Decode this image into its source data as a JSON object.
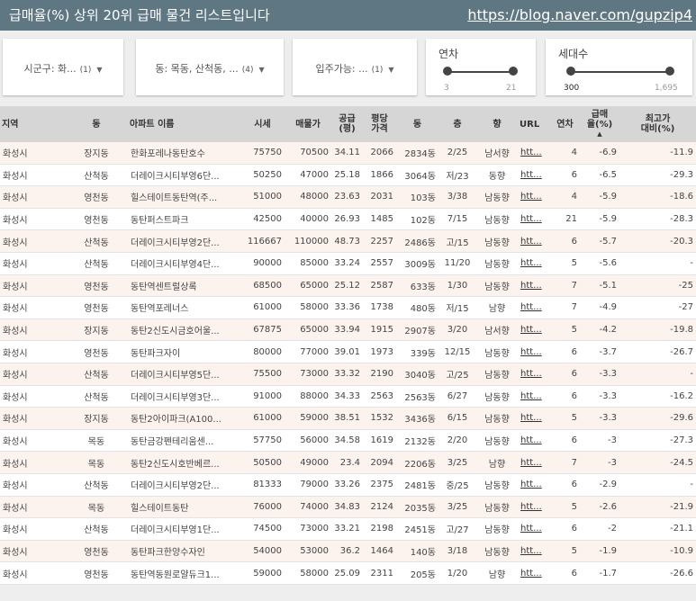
{
  "header": {
    "title": "급매율(%) 상위 20위 급매 물건 리스트입니다",
    "link": "https://blog.naver.com/gupzip4"
  },
  "filters": {
    "sigungu": {
      "label": "시군구: 화...",
      "count": "(1)"
    },
    "dong": {
      "label": "동: 목동, 산척동, ...",
      "count": "(4)"
    },
    "ipju": {
      "label": "입주가능: ...",
      "count": "(1)"
    },
    "yeoncha": {
      "label": "연차",
      "min": "3",
      "max": "21",
      "sel_min_fraction": 0.0,
      "sel_max_fraction": 1.0
    },
    "sedaesu": {
      "label": "세대수",
      "min": "300",
      "max": "1,695",
      "sel_min_fraction": 0.0,
      "sel_max_fraction": 0.86
    }
  },
  "icons": {
    "caret": "caret-down-icon",
    "sort": "sort-arrow-icon"
  },
  "table": {
    "columns": [
      "지역",
      "동",
      "아파트 이름",
      "시세",
      "매물가",
      "공급\n(평)",
      "평당\n가격",
      "동",
      "층",
      "향",
      "URL",
      "연차",
      "급매\n율(%)",
      "최고가\n대비(%)"
    ],
    "sort_arrow": "▲",
    "rows": [
      [
        "화성시",
        "장지동",
        "한화포레나동탄호수",
        "75750",
        "70500",
        "34.11",
        "2066",
        "2834동",
        "2/25",
        "남서향",
        "htt...",
        "4",
        "-6.9",
        "-11.9"
      ],
      [
        "화성시",
        "산척동",
        "더레이크시티부영6단...",
        "50250",
        "47000",
        "25.18",
        "1866",
        "3064동",
        "저/23",
        "동향",
        "htt...",
        "6",
        "-6.5",
        "-29.3"
      ],
      [
        "화성시",
        "영천동",
        "힐스테이트동탄역(주...",
        "51000",
        "48000",
        "23.63",
        "2031",
        "103동",
        "3/38",
        "남동향",
        "htt...",
        "4",
        "-5.9",
        "-18.6"
      ],
      [
        "화성시",
        "영천동",
        "동탄퍼스트파크",
        "42500",
        "40000",
        "26.93",
        "1485",
        "102동",
        "7/15",
        "남동향",
        "htt...",
        "21",
        "-5.9",
        "-28.3"
      ],
      [
        "화성시",
        "산척동",
        "더레이크시티부영2단...",
        "116667",
        "110000",
        "48.73",
        "2257",
        "2486동",
        "고/15",
        "남동향",
        "htt...",
        "6",
        "-5.7",
        "-20.3"
      ],
      [
        "화성시",
        "산척동",
        "더레이크시티부영4단...",
        "90000",
        "85000",
        "33.24",
        "2557",
        "3009동",
        "11/20",
        "남동향",
        "htt...",
        "5",
        "-5.6",
        "-"
      ],
      [
        "화성시",
        "영천동",
        "동탄역센트럴상록",
        "68500",
        "65000",
        "25.12",
        "2587",
        "633동",
        "1/30",
        "남동향",
        "htt...",
        "7",
        "-5.1",
        "-25"
      ],
      [
        "화성시",
        "영천동",
        "동탄역포레너스",
        "61000",
        "58000",
        "33.36",
        "1738",
        "480동",
        "저/15",
        "남향",
        "htt...",
        "7",
        "-4.9",
        "-27"
      ],
      [
        "화성시",
        "장지동",
        "동탄2신도시금호어울...",
        "67875",
        "65000",
        "33.94",
        "1915",
        "2907동",
        "3/20",
        "남서향",
        "htt...",
        "5",
        "-4.2",
        "-19.8"
      ],
      [
        "화성시",
        "영천동",
        "동탄파크자이",
        "80000",
        "77000",
        "39.01",
        "1973",
        "339동",
        "12/15",
        "남동향",
        "htt...",
        "6",
        "-3.7",
        "-26.7"
      ],
      [
        "화성시",
        "산척동",
        "더레이크시티부영5단...",
        "75500",
        "73000",
        "33.32",
        "2190",
        "3040동",
        "고/25",
        "남동향",
        "htt...",
        "6",
        "-3.3",
        "-"
      ],
      [
        "화성시",
        "산척동",
        "더레이크시티부영3단...",
        "91000",
        "88000",
        "34.33",
        "2563",
        "2563동",
        "6/27",
        "남동향",
        "htt...",
        "6",
        "-3.3",
        "-16.2"
      ],
      [
        "화성시",
        "장지동",
        "동탄2아이파크(A100...",
        "61000",
        "59000",
        "38.51",
        "1532",
        "3436동",
        "6/15",
        "남동향",
        "htt...",
        "5",
        "-3.3",
        "-29.6"
      ],
      [
        "화성시",
        "목동",
        "동탄금강펜테리움센...",
        "57750",
        "56000",
        "34.58",
        "1619",
        "2132동",
        "2/20",
        "남동향",
        "htt...",
        "6",
        "-3",
        "-27.3"
      ],
      [
        "화성시",
        "목동",
        "동탄2신도시호반베르...",
        "50500",
        "49000",
        "23.4",
        "2094",
        "2206동",
        "3/25",
        "남향",
        "htt...",
        "7",
        "-3",
        "-24.5"
      ],
      [
        "화성시",
        "산척동",
        "더레이크시티부영2단...",
        "81333",
        "79000",
        "33.26",
        "2375",
        "2481동",
        "중/25",
        "남동향",
        "htt...",
        "6",
        "-2.9",
        "-"
      ],
      [
        "화성시",
        "목동",
        "힐스테이트동탄",
        "76000",
        "74000",
        "34.83",
        "2124",
        "2035동",
        "3/25",
        "남동향",
        "htt...",
        "5",
        "-2.6",
        "-21.9"
      ],
      [
        "화성시",
        "산척동",
        "더레이크시티부영1단...",
        "74500",
        "73000",
        "33.21",
        "2198",
        "2451동",
        "고/27",
        "남동향",
        "htt...",
        "6",
        "-2",
        "-21.1"
      ],
      [
        "화성시",
        "영천동",
        "동탄파크한양수자인",
        "54000",
        "53000",
        "36.2",
        "1464",
        "140동",
        "3/18",
        "남동향",
        "htt...",
        "5",
        "-1.9",
        "-10.9"
      ],
      [
        "화성시",
        "영천동",
        "동탄역동원로얄듀크1...",
        "59000",
        "58000",
        "25.09",
        "2311",
        "205동",
        "1/20",
        "남향",
        "htt...",
        "6",
        "-1.7",
        "-26.6"
      ]
    ]
  }
}
